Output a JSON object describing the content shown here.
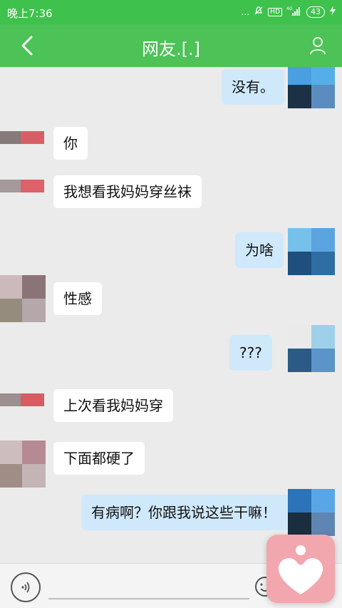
{
  "status_bar": {
    "time": "晚上7:36",
    "icons": [
      "dots-icon",
      "mute-icon",
      "hd-icon",
      "4g-icon",
      "signal-icon"
    ],
    "battery": "43",
    "signal_text": "4G"
  },
  "header": {
    "title": "网友.[.]"
  },
  "messages": [
    {
      "side": "right",
      "text": "没有。"
    },
    {
      "side": "left",
      "text": "你"
    },
    {
      "side": "left",
      "text": "我想看我妈妈穿丝袜"
    },
    {
      "side": "right",
      "text": "为啥"
    },
    {
      "side": "left",
      "text": "性感"
    },
    {
      "side": "right",
      "text": "???"
    },
    {
      "side": "left",
      "text": "上次看我妈妈穿"
    },
    {
      "side": "left",
      "text": "下面都硬了"
    },
    {
      "side": "right",
      "text": "有病啊？你跟我说这些干嘛！"
    }
  ],
  "colors": {
    "header_green": "#4cc257",
    "status_green": "#3fc24d",
    "right_bubble": "#cfe9fb",
    "left_bubble": "#ffffff",
    "background": "#ebebeb"
  }
}
